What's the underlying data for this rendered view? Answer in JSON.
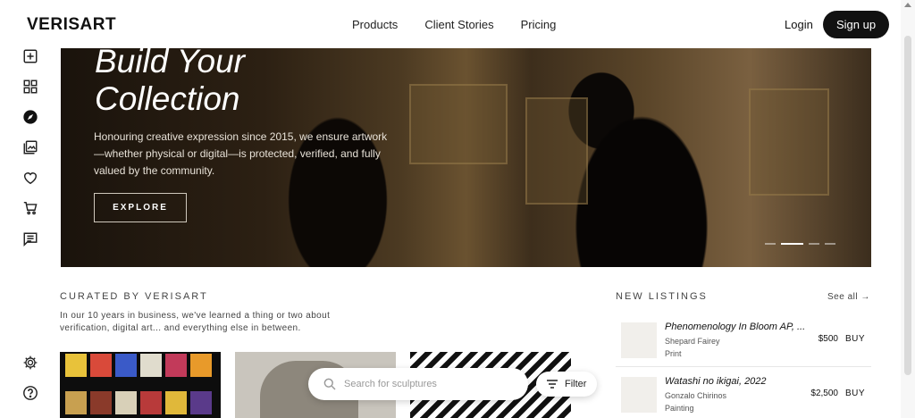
{
  "header": {
    "logo": "VERISART",
    "nav": [
      "Products",
      "Client Stories",
      "Pricing"
    ],
    "login": "Login",
    "signup": "Sign up"
  },
  "rail": {
    "top_icons": [
      "add-box-icon",
      "dashboard-icon",
      "explore-compass-icon",
      "gallery-icon",
      "heart-icon",
      "cart-icon",
      "message-icon"
    ],
    "bottom_icons": [
      "gear-icon",
      "help-icon"
    ],
    "active": "explore-compass-icon"
  },
  "hero": {
    "title_line1": "Build Your",
    "title_line2": "Collection",
    "text": "Honouring creative expression since 2015, we ensure artwork —whether physical or digital—is protected, verified, and fully valued by the community.",
    "button": "EXPLORE",
    "slides": 4,
    "active_slide": 2
  },
  "curated": {
    "title": "CURATED BY VERISART",
    "description": "In our 10 years in business, we've learned a thing or two about verification, digital art... and everything else in between."
  },
  "search": {
    "placeholder": "Search for sculptures",
    "filter_label": "Filter"
  },
  "new_listings": {
    "title": "NEW LISTINGS",
    "see_all": "See all →",
    "items": [
      {
        "title": "Phenomenology In Bloom AP, ...",
        "artist": "Shepard Fairey",
        "medium": "Print",
        "price": "$500",
        "action": "BUY"
      },
      {
        "title": "Watashi no ikigai, 2022",
        "artist": "Gonzalo Chirinos",
        "medium": "Painting",
        "price": "$2,500",
        "action": "BUY"
      }
    ]
  },
  "colors": {
    "primary": "#111111",
    "background": "#ffffff",
    "muted_text": "#444444"
  }
}
